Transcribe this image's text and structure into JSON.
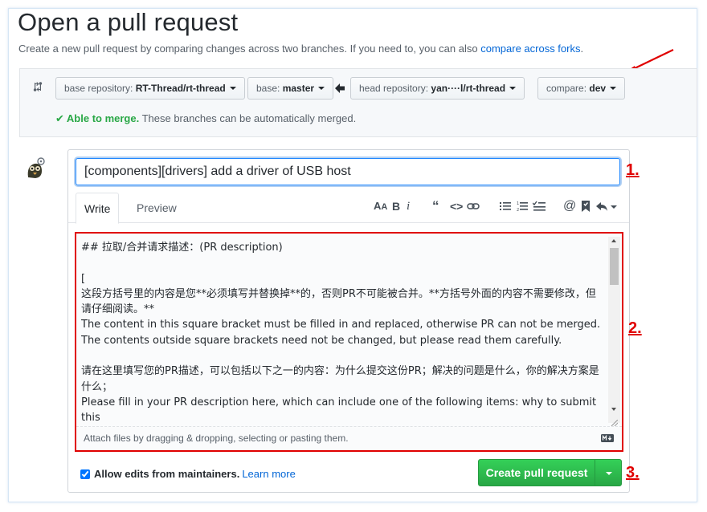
{
  "page": {
    "title": "Open a pull request",
    "subtitle_text": "Create a new pull request by comparing changes across two branches. If you need to, you can also ",
    "subtitle_link": "compare across forks",
    "subtitle_end": "."
  },
  "range": {
    "base_repo_label": "base repository: ",
    "base_repo_value": "RT-Thread/rt-thread",
    "base_label": "base: ",
    "base_value": "master",
    "head_repo_label": "head repository: ",
    "head_repo_value": "yan····l/rt-thread",
    "compare_label": "compare: ",
    "compare_value": "dev",
    "merge_status": "Able to merge.",
    "merge_detail": " These branches can be automatically merged."
  },
  "composer": {
    "title_value": "[components][drivers] add a driver of USB host",
    "tab_write": "Write",
    "tab_preview": "Preview",
    "body_lines": [
      "## 拉取/合并请求描述：(PR description)",
      "",
      "[",
      "这段方括号里的内容是您**必须填写并替换掉**的，否则PR不可能被合并。**方括号外面的内容不需要修改，但请仔细阅读。**",
      "The content in this square bracket must be filled in and replaced, otherwise PR can not be merged. The contents outside square brackets need not be changed, but please read them carefully.",
      "",
      "请在这里填写您的PR描述，可以包括以下之一的内容：为什么提交这份PR；解决的问题是什么，你的解决方案是什么；",
      "Please fill in your PR description here, which can include one of the following items: why to submit this"
    ],
    "attach_hint": "Attach files by dragging & dropping, selecting or pasting them."
  },
  "footer": {
    "allow_edits_label": "Allow edits from maintainers.",
    "learn_more": "Learn more",
    "allow_edits_checked": true,
    "create_button": "Create pull request"
  },
  "annotations": {
    "step1": "1.",
    "step2": "2.",
    "step3": "3."
  },
  "toolbar": {
    "icons": [
      "text-size-icon",
      "bold-icon",
      "italic-icon",
      "quote-icon",
      "code-icon",
      "link-icon",
      "unordered-list-icon",
      "ordered-list-icon",
      "task-list-icon",
      "mention-icon",
      "saved-reply-icon",
      "reply-icon"
    ]
  },
  "colors": {
    "accent_blue": "#0366d6",
    "success_green": "#28a745",
    "annotation_red": "#e00000"
  }
}
